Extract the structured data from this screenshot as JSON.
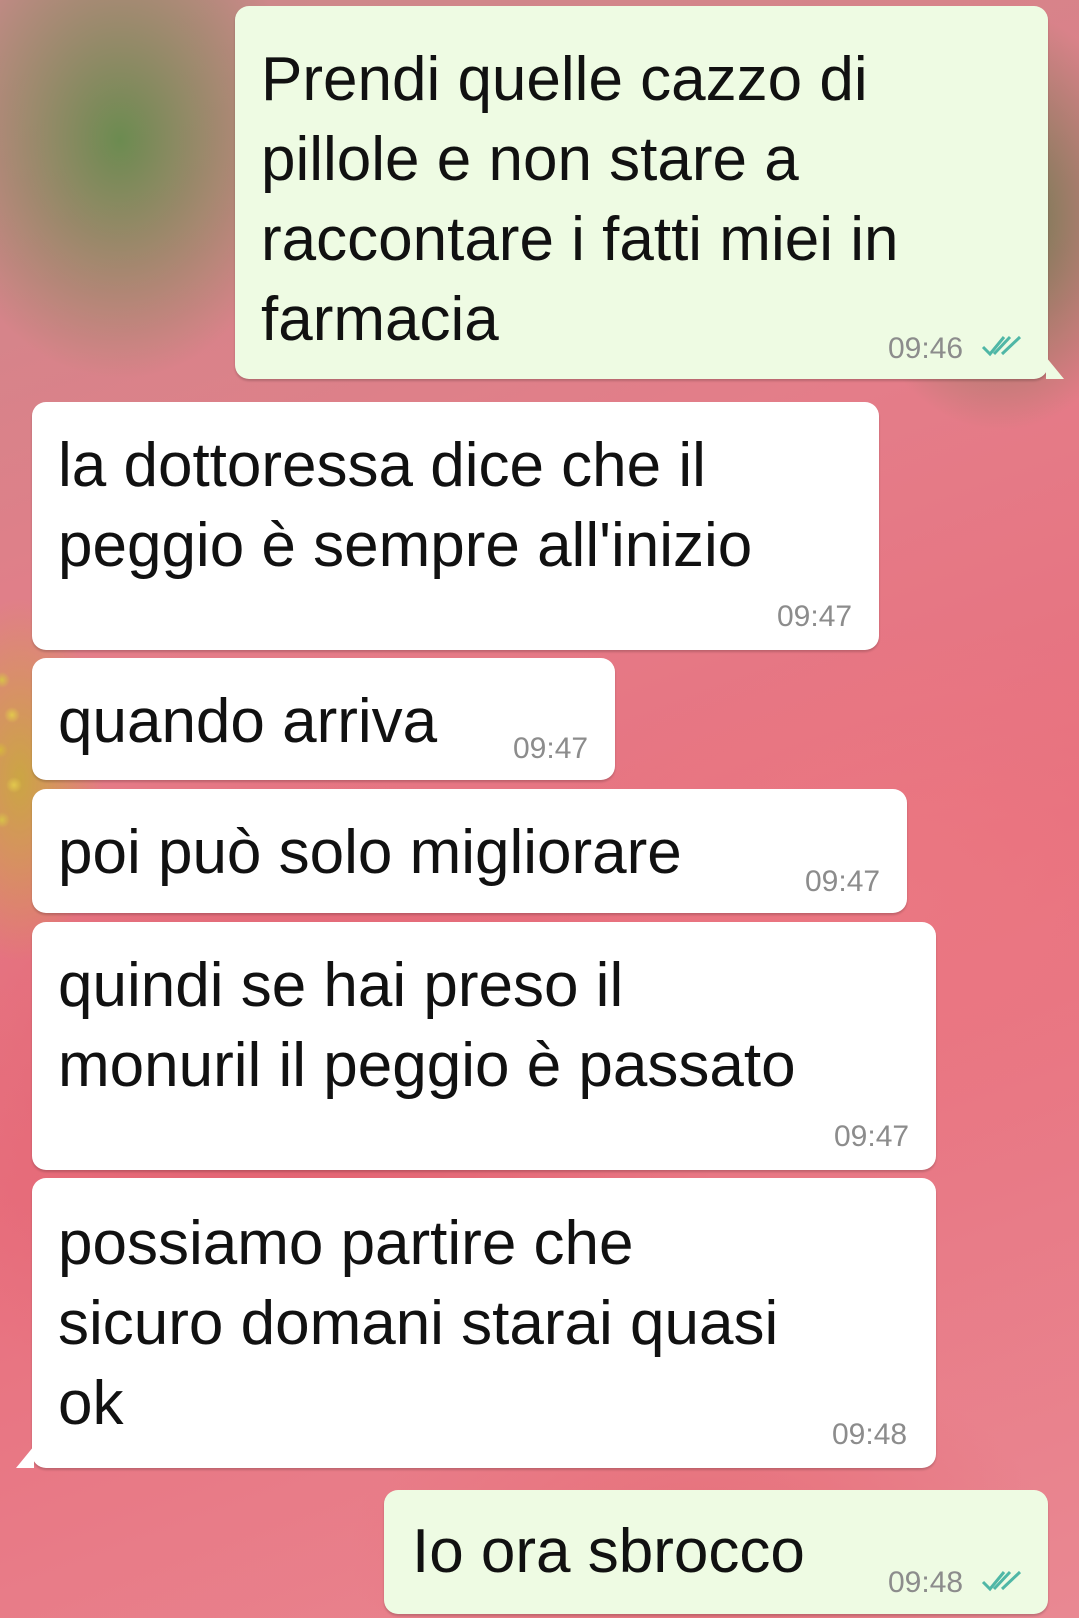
{
  "colors": {
    "incoming_bubble": "#ffffff",
    "outgoing_bubble": "#eefbe3",
    "timestamp": "#8c8c8c",
    "read_ticks": "#4fb7a6"
  },
  "messages": [
    {
      "direction": "outgoing",
      "text": "Prendi quelle cazzo di\npillole e non stare a\nraccontare i fatti miei in\nfarmacia",
      "time": "09:46",
      "status_icon": "double-check-read-icon"
    },
    {
      "direction": "incoming",
      "text": "la dottoressa dice che il\npeggio è sempre all'inizio",
      "time": "09:47"
    },
    {
      "direction": "incoming",
      "text": "quando arriva",
      "time": "09:47"
    },
    {
      "direction": "incoming",
      "text": "poi può solo migliorare",
      "time": "09:47"
    },
    {
      "direction": "incoming",
      "text": "quindi se hai preso il\nmonuril il peggio è passato",
      "time": "09:47"
    },
    {
      "direction": "incoming",
      "text": "possiamo partire che\nsicuro domani starai quasi\nok",
      "time": "09:48"
    },
    {
      "direction": "outgoing",
      "text": "Io ora sbrocco",
      "time": "09:48",
      "status_icon": "double-check-read-icon"
    }
  ]
}
